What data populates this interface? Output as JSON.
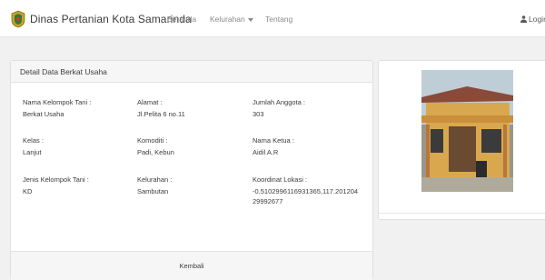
{
  "navbar": {
    "brand": "Dinas Pertanian Kota Samarinda",
    "links": {
      "beranda": "Beranda",
      "kelurahan": "Kelurahan",
      "tentang": "Tentang"
    },
    "login": "Login"
  },
  "detail": {
    "title": "Detail Data Berkat Usaha",
    "fields": {
      "nama_kelompok": {
        "label": "Nama Kelompok Tani :",
        "value": "Berkat Usaha"
      },
      "alamat": {
        "label": "Alamat :",
        "value": "Jl.Pelita 6 no.11"
      },
      "jumlah_anggota": {
        "label": "Jumlah Anggota :",
        "value": "303"
      },
      "kelas": {
        "label": "Kelas :",
        "value": "Lanjut"
      },
      "komoditi": {
        "label": "Komoditi :",
        "value": "Padi, Kebun"
      },
      "nama_ketua": {
        "label": "Nama Ketua :",
        "value": "Aidil A.R"
      },
      "jenis_kelompok": {
        "label": "Jenis Kelompok Tani :",
        "value": "KD"
      },
      "kelurahan": {
        "label": "Kelurahan :",
        "value": "Sambutan"
      },
      "koordinat": {
        "label": "Koordinat Lokasi :",
        "value": "-0.5102996116931365,117.20120429992677"
      }
    },
    "back_button": "Kembali"
  },
  "photo": {
    "alt": "house-photo"
  },
  "colors": {
    "navbar_bg": "#ffffff",
    "page_bg": "#f1f1f1",
    "card_header_bg": "#f6f6f6"
  }
}
